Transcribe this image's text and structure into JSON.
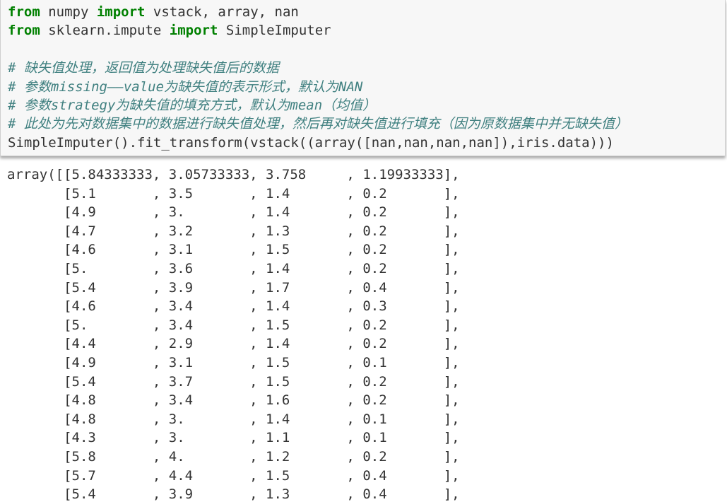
{
  "input_cell": {
    "line1": {
      "kw_from": "from",
      "module": " numpy ",
      "kw_import": "import",
      "names": " vstack, array, nan"
    },
    "line2": {
      "kw_from": "from",
      "module": " sklearn.impute ",
      "kw_import": "import",
      "names": " SimpleImputer"
    },
    "comments": [
      "# 缺失值处理，返回值为处理缺失值后的数据",
      "# 参数missing——value为缺失值的表示形式，默认为NAN",
      "# 参数strategy为缺失值的填充方式，默认为mean（均值）",
      "# 此处为先对数据集中的数据进行缺失值处理，然后再对缺失值进行填充（因为原数据集中并无缺失值）"
    ],
    "call_line": "SimpleImputer().fit_transform(vstack((array([nan,nan,nan,nan]),iris.data)))"
  },
  "output_cell": {
    "lines": [
      "array([[5.84333333, 3.05733333, 3.758     , 1.19933333],",
      "       [5.1       , 3.5       , 1.4       , 0.2       ],",
      "       [4.9       , 3.        , 1.4       , 0.2       ],",
      "       [4.7       , 3.2       , 1.3       , 0.2       ],",
      "       [4.6       , 3.1       , 1.5       , 0.2       ],",
      "       [5.        , 3.6       , 1.4       , 0.2       ],",
      "       [5.4       , 3.9       , 1.7       , 0.4       ],",
      "       [4.6       , 3.4       , 1.4       , 0.3       ],",
      "       [5.        , 3.4       , 1.5       , 0.2       ],",
      "       [4.4       , 2.9       , 1.4       , 0.2       ],",
      "       [4.9       , 3.1       , 1.5       , 0.1       ],",
      "       [5.4       , 3.7       , 1.5       , 0.2       ],",
      "       [4.8       , 3.4       , 1.6       , 0.2       ],",
      "       [4.8       , 3.        , 1.4       , 0.1       ],",
      "       [4.3       , 3.        , 1.1       , 0.1       ],",
      "       [5.8       , 4.        , 1.2       , 0.2       ],",
      "       [5.7       , 4.4       , 1.5       , 0.4       ],",
      "       [5.4       , 3.9       , 1.3       , 0.4       ],"
    ]
  },
  "colors": {
    "keyword": "#008000",
    "comment": "#408080",
    "text": "#333333",
    "input_background": "#f7f7f7"
  }
}
